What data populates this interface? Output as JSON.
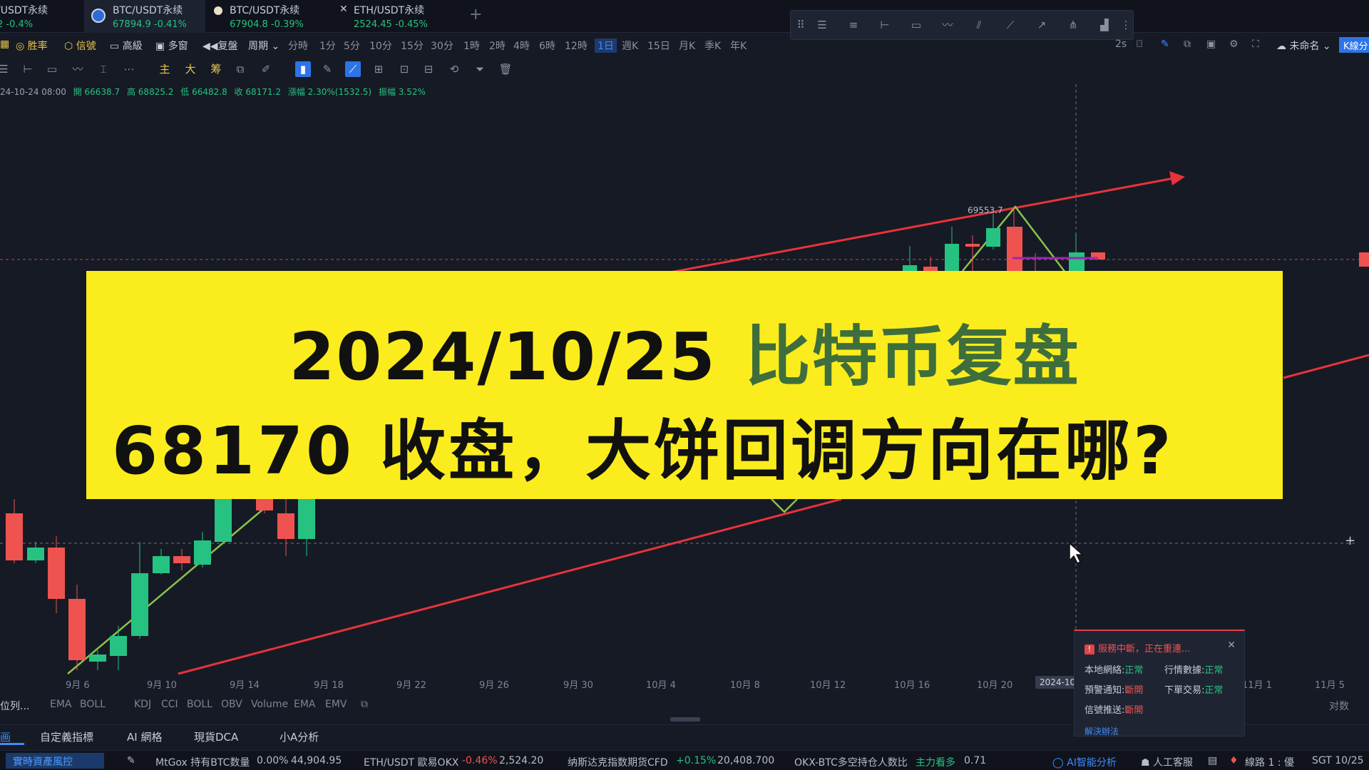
{
  "tabs": [
    {
      "name": "/USDT永续",
      "quote": "2 -0.4%"
    },
    {
      "name": "BTC/USDT永续",
      "quote": "67894.9 -0.41%"
    },
    {
      "name": "BTC/USDT永续",
      "quote": "67904.8 -0.39%"
    },
    {
      "name": "ETH/USDT永续",
      "quote": "2524.45 -0.45%"
    }
  ],
  "add_tab": "+",
  "periodbar": {
    "items_left": [
      "胜率",
      "信號",
      "高級",
      "多窗",
      "复盤",
      "周期"
    ],
    "periods": [
      "分時",
      "1分",
      "5分",
      "10分",
      "15分",
      "30分",
      "1時",
      "2時",
      "4時",
      "6時",
      "12時",
      "1日",
      "週K",
      "15日",
      "月K",
      "季K",
      "年K"
    ],
    "selected_period": "1日",
    "right": {
      "interval": "2s",
      "layout_name": "未命名",
      "kline_btn": "K線分"
    }
  },
  "toolbar2": {
    "labels": [
      "主",
      "大",
      "筹"
    ]
  },
  "ohlc": {
    "date": "24-10-24 08:00",
    "open": "開 66638.7",
    "high": "高 68825.2",
    "low": "低 66482.8",
    "close": "收 68171.2",
    "change": "漲幅 2.30%(1532.5)",
    "amplitude": "振幅 3.52%"
  },
  "chart_data": {
    "type": "candlestick",
    "annotation": "69553.7",
    "x_ticks": [
      "9月 6",
      "9月 10",
      "9月 14",
      "9月 18",
      "9月 22",
      "9月 26",
      "9月 30",
      "10月 4",
      "10月 8",
      "10月 12",
      "10月 16",
      "10月 20",
      "2024-10",
      "11月 1",
      "11月 5"
    ],
    "cursor_label": "2024-10",
    "candles_visible": [
      {
        "dir": "down",
        "o": 0.74,
        "c": 0.86,
        "h": 0.7,
        "l": 0.88
      },
      {
        "dir": "up",
        "o": 0.86,
        "c": 0.84,
        "h": 0.82,
        "l": 0.89
      },
      {
        "dir": "down",
        "o": 0.84,
        "c": 0.92,
        "h": 0.8,
        "l": 0.95
      },
      {
        "dir": "down",
        "o": 0.92,
        "c": 1.0,
        "h": 0.9,
        "l": 1.02
      }
    ],
    "right_axis_label": "对数"
  },
  "banner": {
    "date": "2024/10/25",
    "title": "比特币复盘",
    "line2": "68170 收盘，大饼回调方向在哪?"
  },
  "indicators": {
    "left": "位列...",
    "main": [
      "EMA",
      "BOLL"
    ],
    "sub": [
      "KDJ",
      "CCI",
      "BOLL",
      "OBV",
      "Volume",
      "EMA",
      "EMV"
    ]
  },
  "bottom_tabs": [
    "画",
    "自定義指標",
    "AI 網格",
    "現貨DCA",
    "小A分析"
  ],
  "statusbar": {
    "risk": "實時資產風控",
    "items": [
      {
        "label": "MtGox 持有BTC数量",
        "pct": "0.00%",
        "value": "44,904.95"
      },
      {
        "label": "ETH/USDT 歐易OKX",
        "pct": "-0.46%",
        "value": "2,524.20"
      },
      {
        "label": "纳斯达克指数期货CFD",
        "pct": "+0.15%",
        "value": "20,408.700"
      },
      {
        "label": "OKX-BTC多空持仓人数比",
        "pct": "主力看多",
        "value": "0.71"
      }
    ],
    "ai": "AI智能分析",
    "support": "人工客服",
    "route": "線路 1 : 優",
    "time": "SGT 10/25"
  },
  "net_panel": {
    "title": "服務中斷，正在重連...",
    "rows": [
      {
        "label": "本地網絡:",
        "value": "正常",
        "status": "ok"
      },
      {
        "label": "行情數據:",
        "value": "正常",
        "status": "ok"
      },
      {
        "label": "預警通知:",
        "value": "斷開",
        "status": "bad"
      },
      {
        "label": "下單交易:",
        "value": "正常",
        "status": "ok"
      },
      {
        "label": "信號推送:",
        "value": "斷開",
        "status": "bad"
      }
    ],
    "fix": "解決辦法",
    "close": "✕"
  },
  "colors": {
    "up": "#26c281",
    "down": "#ef5350",
    "trend": "#e8333a",
    "pattern": "#8bc34a",
    "banner": "#fbec1e"
  }
}
